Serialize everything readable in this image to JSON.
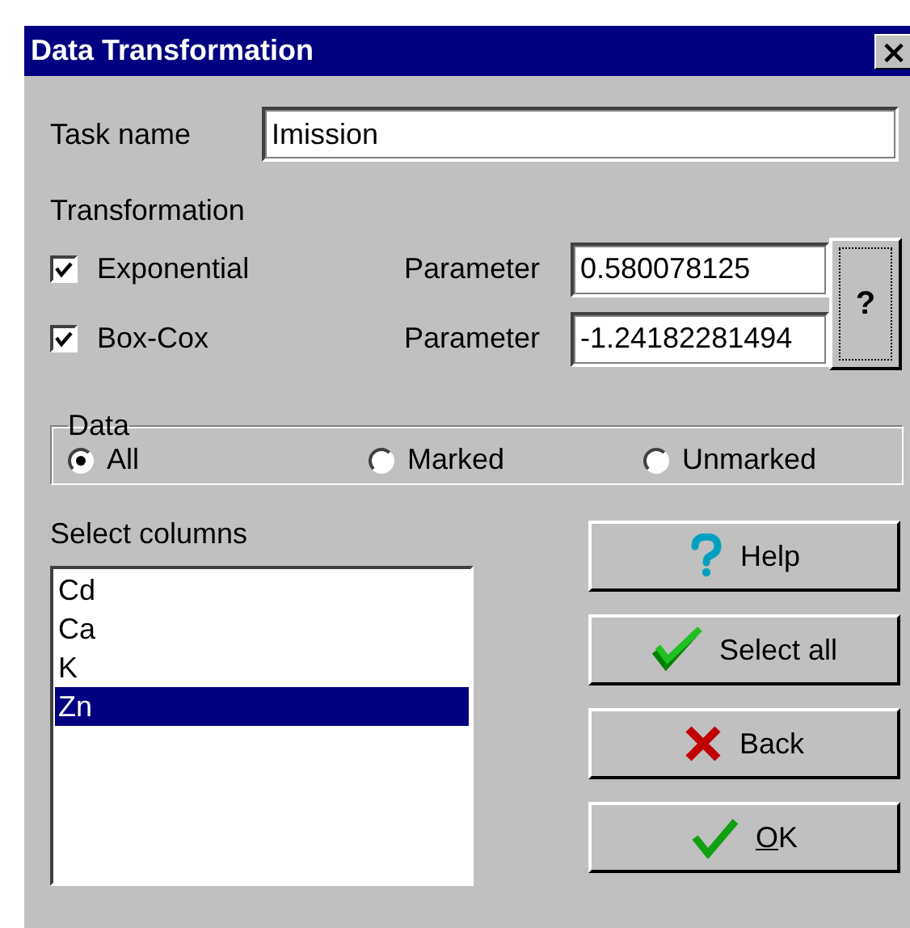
{
  "window": {
    "title": "Data Transformation",
    "close_label": "×"
  },
  "task_name": {
    "label": "Task name",
    "value": "Imission"
  },
  "transformation": {
    "label": "Transformation",
    "help_button": "?",
    "rows": [
      {
        "label": "Exponential",
        "checked": true,
        "parameter_label": "Parameter",
        "parameter_value": "0.580078125"
      },
      {
        "label": "Box-Cox",
        "checked": true,
        "parameter_label": "Parameter",
        "parameter_value": "-1.24182281494"
      }
    ]
  },
  "data_group": {
    "label": "Data",
    "options": [
      {
        "label": "All",
        "selected": true
      },
      {
        "label": "Marked",
        "selected": false
      },
      {
        "label": "Unmarked",
        "selected": false
      }
    ]
  },
  "columns": {
    "label": "Select columns",
    "items": [
      {
        "label": "Cd",
        "selected": false
      },
      {
        "label": "Ca",
        "selected": false
      },
      {
        "label": "K",
        "selected": false
      },
      {
        "label": "Zn",
        "selected": true
      }
    ]
  },
  "buttons": [
    {
      "kind": "help",
      "label": "Help",
      "mnemonic_underlined": false
    },
    {
      "kind": "select_all",
      "label": "Select all",
      "mnemonic_underlined": false
    },
    {
      "kind": "back",
      "label": "Back",
      "mnemonic_underlined": false
    },
    {
      "kind": "ok",
      "label": "OK",
      "mnemonic_underlined": true
    }
  ]
}
